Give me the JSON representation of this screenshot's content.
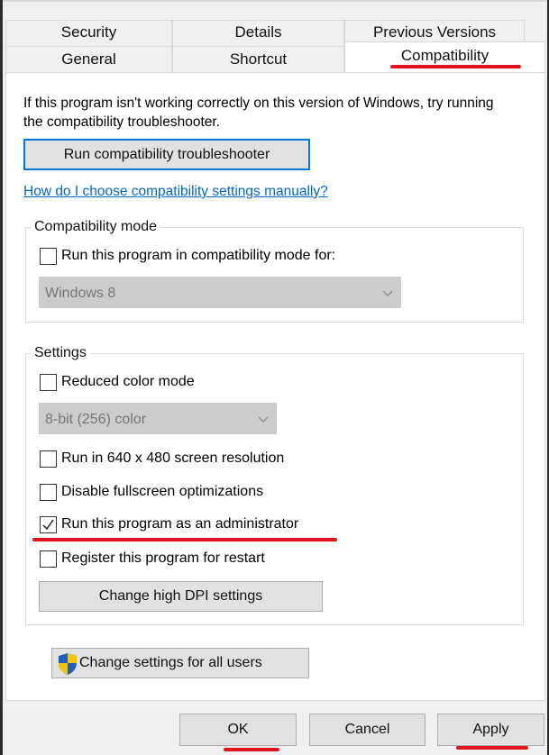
{
  "tabs": {
    "row1": [
      "Security",
      "Details",
      "Previous Versions"
    ],
    "row2": [
      "General",
      "Shortcut",
      "Compatibility"
    ],
    "active": "Compatibility"
  },
  "intro_text": "If this program isn't working correctly on this version of Windows, try running the compatibility troubleshooter.",
  "troubleshooter_button": "Run compatibility troubleshooter",
  "help_link": "How do I choose compatibility settings manually?",
  "compat_mode": {
    "title": "Compatibility mode",
    "checkbox_label": "Run this program in compatibility mode for:",
    "checked": false,
    "select_value": "Windows 8"
  },
  "settings": {
    "title": "Settings",
    "reduced_color": {
      "label": "Reduced color mode",
      "checked": false
    },
    "color_select_value": "8-bit (256) color",
    "resolution": {
      "label": "Run in 640 x 480 screen resolution",
      "checked": false
    },
    "fullscreen": {
      "label": "Disable fullscreen optimizations",
      "checked": false
    },
    "admin": {
      "label": "Run this program as an administrator",
      "checked": true
    },
    "restart": {
      "label": "Register this program for restart",
      "checked": false
    },
    "dpi_button": "Change high DPI settings"
  },
  "all_users_button": "Change settings for all users",
  "footer": {
    "ok": "OK",
    "cancel": "Cancel",
    "apply": "Apply"
  },
  "colors": {
    "highlight_red": "#e0141e",
    "link_blue": "#0066cc",
    "focus_blue": "#0078d7",
    "shield_blue": "#1f5fbf",
    "shield_yellow": "#f5c400"
  },
  "icons": {
    "shield": "uac-shield-icon",
    "checkmark": "checkmark-icon",
    "dropdown": "chevron-down-icon"
  }
}
